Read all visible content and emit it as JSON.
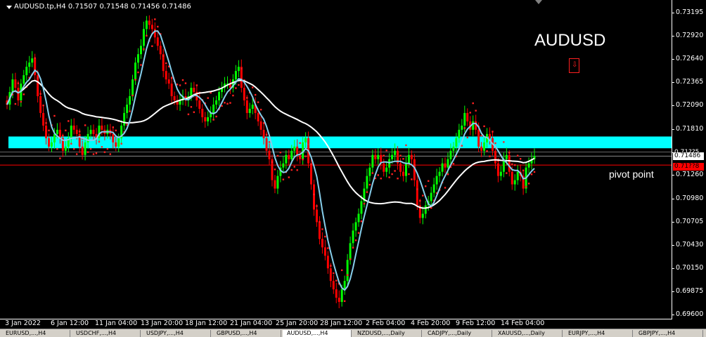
{
  "header": {
    "symbol_info": "AUDUSD.tp,H4  0.71507 0.71548 0.71456 0.71486"
  },
  "symbol_title": "AUDUSD",
  "pivot_label": "pivot point",
  "current_price": "0.71486",
  "upper_price_label": "0.71??5",
  "pivot_price_label": "0.71??8",
  "colors": {
    "background": "#000000",
    "bull_candle": "#00ff00",
    "bear_candle": "#ff0000",
    "sar_dots": "#ff2020",
    "ma_fast": "#87ceeb",
    "ma_slow": "#ffffff",
    "zone": "#00ffff",
    "pivot_line": "#ff0000"
  },
  "price_axis": {
    "ticks": [
      "0.73195",
      "0.72920",
      "0.72640",
      "0.72365",
      "0.72090",
      "0.71810",
      "0.71535",
      "0.71260",
      "0.70980",
      "0.70705",
      "0.70430",
      "0.70150",
      "0.69875",
      "0.69600"
    ]
  },
  "time_axis": {
    "ticks": [
      "3 Jan 2022",
      "6 Jan 12:00",
      "11 Jan 04:00",
      "13 Jan 20:00",
      "18 Jan 12:00",
      "21 Jan 04:00",
      "25 Jan 20:00",
      "28 Jan 12:00",
      "2 Feb 04:00",
      "4 Feb 20:00",
      "9 Feb 12:00",
      "14 Feb 04:00"
    ]
  },
  "tabs": [
    "EURUSD,...,H4",
    "USDCHF,...,H4",
    "USDJPY,...,H4",
    "GBPUSD,...,H4",
    "AUDUSD,...,H4",
    "NZDUSD,...,Daily",
    "CADJPY,...,Daily",
    "XAUUSD,...,Daily",
    "EURJPY,...,H4",
    "GBPJPY,...,H4"
  ],
  "active_tab": 4,
  "chart_data": {
    "type": "candlestick",
    "title": "AUDUSD",
    "ylim": [
      0.696,
      0.733
    ],
    "zone": [
      0.7158,
      0.7172
    ],
    "pivot": 0.7138,
    "current": 0.71486,
    "closes": [
      0.721,
      0.7225,
      0.724,
      0.723,
      0.7215,
      0.7235,
      0.7245,
      0.7255,
      0.726,
      0.7265,
      0.7245,
      0.722,
      0.72,
      0.7185,
      0.717,
      0.716,
      0.7165,
      0.7175,
      0.718,
      0.717,
      0.7155,
      0.716,
      0.717,
      0.7185,
      0.718,
      0.7175,
      0.716,
      0.715,
      0.7165,
      0.7175,
      0.718,
      0.7175,
      0.717,
      0.7185,
      0.718,
      0.7175,
      0.718,
      0.7175,
      0.7165,
      0.716,
      0.717,
      0.7185,
      0.72,
      0.721,
      0.722,
      0.724,
      0.726,
      0.727,
      0.728,
      0.73,
      0.731,
      0.7305,
      0.73,
      0.729,
      0.728,
      0.727,
      0.725,
      0.724,
      0.7235,
      0.722,
      0.7215,
      0.721,
      0.7215,
      0.722,
      0.7215,
      0.722,
      0.723,
      0.7225,
      0.7215,
      0.7205,
      0.7195,
      0.719,
      0.7195,
      0.72,
      0.721,
      0.7215,
      0.7225,
      0.723,
      0.7235,
      0.7235,
      0.723,
      0.724,
      0.725,
      0.7255,
      0.723,
      0.7215,
      0.72,
      0.7205,
      0.721,
      0.72,
      0.719,
      0.718,
      0.717,
      0.7155,
      0.7145,
      0.712,
      0.711,
      0.7125,
      0.7135,
      0.714,
      0.715,
      0.7145,
      0.7155,
      0.716,
      0.715,
      0.7145,
      0.7165,
      0.717,
      0.714,
      0.7115,
      0.7085,
      0.707,
      0.705,
      0.704,
      0.703,
      0.7015,
      0.7,
      0.699,
      0.698,
      0.6975,
      0.699,
      0.7,
      0.7025,
      0.7045,
      0.706,
      0.707,
      0.708,
      0.7095,
      0.711,
      0.7125,
      0.7135,
      0.715,
      0.7145,
      0.715,
      0.714,
      0.713,
      0.7135,
      0.7145,
      0.715,
      0.7155,
      0.714,
      0.713,
      0.7125,
      0.714,
      0.715,
      0.7145,
      0.712,
      0.709,
      0.7075,
      0.708,
      0.709,
      0.7095,
      0.7105,
      0.7115,
      0.7125,
      0.713,
      0.714,
      0.7135,
      0.7145,
      0.7155,
      0.716,
      0.717,
      0.718,
      0.7185,
      0.72,
      0.719,
      0.718,
      0.719,
      0.718,
      0.716,
      0.7155,
      0.7165,
      0.7175,
      0.717,
      0.7155,
      0.714,
      0.7125,
      0.713,
      0.7145,
      0.715,
      0.713,
      0.7115,
      0.712,
      0.713,
      0.7125,
      0.711,
      0.7135,
      0.714,
      0.7145,
      0.7149
    ]
  }
}
